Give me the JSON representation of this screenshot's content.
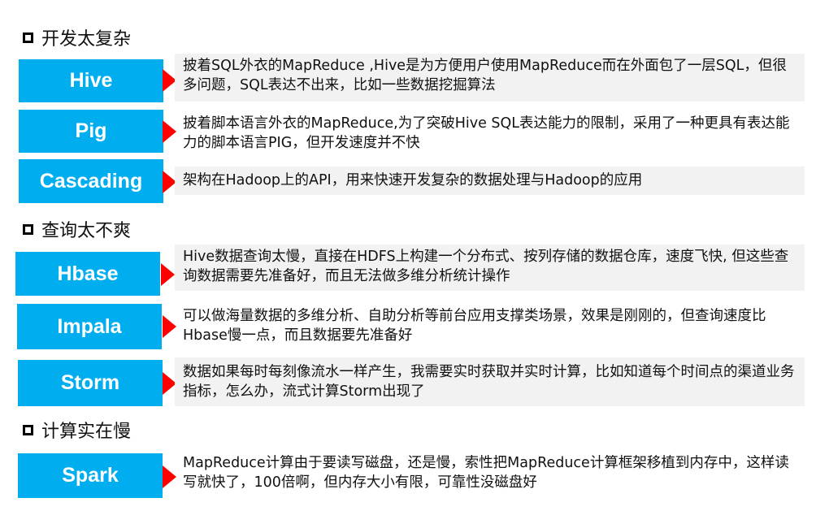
{
  "sections": [
    {
      "title": "开发太复杂",
      "items": [
        {
          "name": "Hive",
          "desc": "披着SQL外衣的MapReduce ,Hive是为方便用户使用MapReduce而在外面包了一层SQL，但很多问题，SQL表达不出来，比如一些数据挖掘算法"
        },
        {
          "name": "Pig",
          "desc": "披着脚本语言外衣的MapReduce,为了突破Hive  SQL表达能力的限制，采用了一种更具有表达能力的脚本语言PIG，但开发速度并不快"
        },
        {
          "name": "Cascading",
          "desc": "架构在Hadoop上的API，用来快速开发复杂的数据处理与Hadoop的应用"
        }
      ]
    },
    {
      "title": "查询太不爽",
      "items": [
        {
          "name": "Hbase",
          "desc": "Hive数据查询太慢，直接在HDFS上构建一个分布式、按列存储的数据仓库，速度飞快, 但这些查询数据需要先准备好，而且无法做多维分析统计操作"
        },
        {
          "name": "Impala",
          "desc": "可以做海量数据的多维分析、自助分析等前台应用支撑类场景，效果是刚刚的，但查询速度比Hbase慢一点，而且数据要先准备好"
        },
        {
          "name": "Storm",
          "desc": "数据如果每时每刻像流水一样产生，我需要实时获取并实时计算，比如知道每个时间点的渠道业务指标，怎么办，流式计算Storm出现了"
        }
      ]
    },
    {
      "title": "计算实在慢",
      "items": [
        {
          "name": "Spark",
          "desc": "MapReduce计算由于要读写磁盘，还是慢，索性把MapReduce计算框架移植到内存中，这样读写就快了，100倍啊，但内存大小有限，可靠性没磁盘好"
        }
      ]
    }
  ],
  "colors": {
    "tag": "#00aeef",
    "arrow": "#ff0000",
    "desc_bg": "#f2f2f2"
  }
}
